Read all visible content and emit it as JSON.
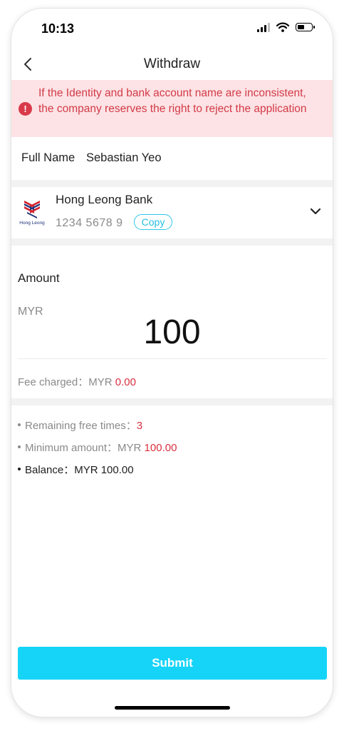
{
  "status_bar": {
    "time": "10:13",
    "icons": [
      "signal-icon",
      "wifi-icon",
      "battery-icon"
    ],
    "battery_level": 0.55
  },
  "header": {
    "title": "Withdraw",
    "back_icon": "chevron-left-icon"
  },
  "warning": {
    "icon": "exclamation-icon",
    "text": "If the Identity and bank account name are inconsistent, the company reserves the right to reject the application"
  },
  "account": {
    "full_name_label": "Full Name",
    "full_name": "Sebastian Yeo"
  },
  "bank": {
    "logo": "hong-leong-bank-logo",
    "logo_text": "Hong Leong",
    "name": "Hong Leong Bank",
    "account_number": "1234 5678 9",
    "copy_label": "Copy",
    "dropdown_icon": "chevron-down-icon"
  },
  "amount": {
    "label": "Amount",
    "currency": "MYR",
    "value": "100",
    "fee_label": "Fee charged：MYR ",
    "fee_value": "0.00"
  },
  "info": {
    "remaining_label": "Remaining free times：",
    "remaining_value": "3",
    "minimum_label": "Minimum amount：MYR ",
    "minimum_value": "100.00",
    "balance_label": "Balance：MYR 100.00"
  },
  "actions": {
    "submit_label": "Submit"
  },
  "colors": {
    "accent": "#16d4f8",
    "warning_bg": "#fde3e5",
    "warning_text": "#d23a48",
    "highlight_red": "#d8303f"
  }
}
